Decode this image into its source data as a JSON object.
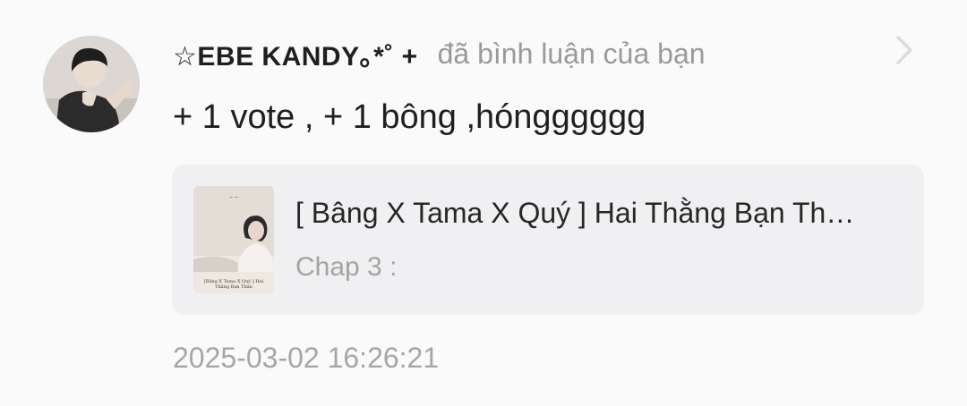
{
  "notification": {
    "username": "☆EBE KANDY｡*˚ +",
    "action_text": "đã bình luận của bạn",
    "comment_text": "+ 1 vote , + 1 bông ,hóngggggg",
    "timestamp": "2025-03-02 16:26:21",
    "icons": {
      "avatar": "user-avatar-photo",
      "chevron": "chevron-right-icon"
    },
    "story_card": {
      "title": "[ Bâng X Tama X Quý ] Hai Thằng Bạn Th…",
      "chapter": "Chap 3 :",
      "cover_text": "[Bâng X Tama X Quý ] Hai Thằng Bạn Thân"
    }
  }
}
